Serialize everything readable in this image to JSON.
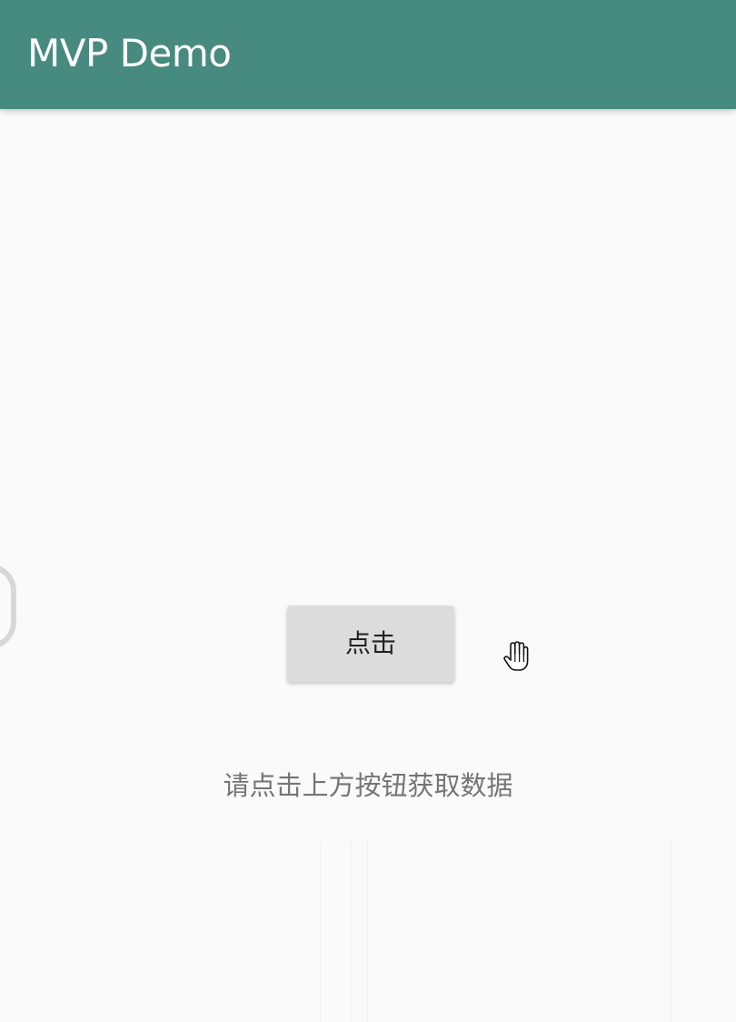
{
  "app_bar": {
    "title": "MVP Demo",
    "color": "#478a7f"
  },
  "main": {
    "button_label": "点击",
    "hint_text": "请点击上方按钮获取数据"
  },
  "icons": {
    "cursor": "hand-cursor-icon"
  }
}
